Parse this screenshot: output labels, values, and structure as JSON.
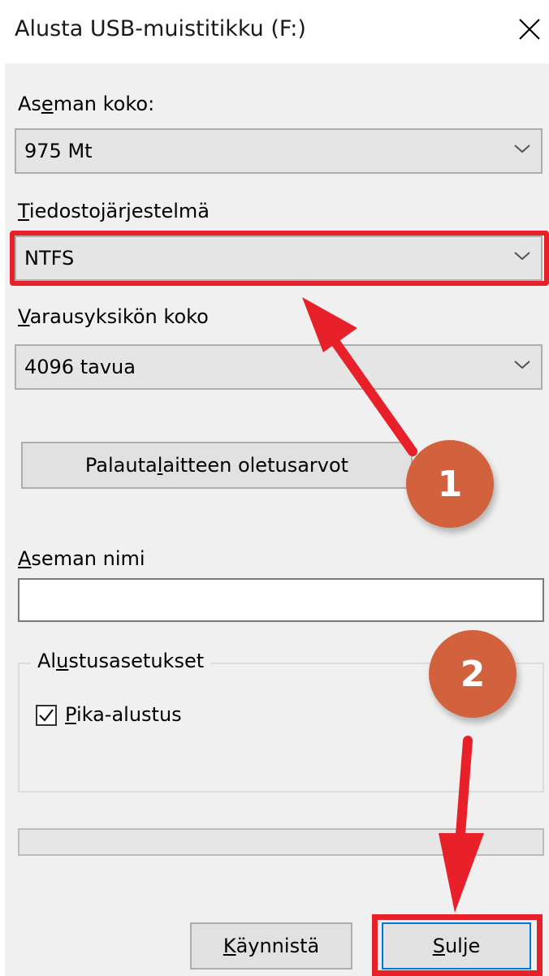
{
  "window": {
    "title": "Alusta USB-muistitikku (F:)",
    "close_glyph": "✕"
  },
  "capacity": {
    "label_pre": "As",
    "label_key": "e",
    "label_post": "man koko:",
    "value": "975 Mt"
  },
  "file_system": {
    "label_key": "T",
    "label_post": "iedostojärjestelmä",
    "value": "NTFS"
  },
  "allocation": {
    "label_key": "V",
    "label_post": "arausyksikön koko",
    "value": "4096 tavua"
  },
  "restore_button": {
    "label_pre": "Palauta ",
    "label_key": "l",
    "label_post": "aitteen oletusarvot"
  },
  "volume_label": {
    "label_key": "A",
    "label_post": "seman nimi",
    "value": ""
  },
  "format_options": {
    "title_pre": "Al",
    "title_key": "u",
    "title_post": "stusasetukset",
    "quick_format": {
      "label_key": "P",
      "label_post": "ika-alustus",
      "checked": true
    }
  },
  "progress": {
    "value": 0
  },
  "buttons": {
    "start_key": "K",
    "start_post": "äynnistä",
    "close_key": "S",
    "close_post": "ulje"
  },
  "annotations": {
    "badge_1": "1",
    "badge_2": "2",
    "highlight_color": "#e8202a",
    "badge_color": "#d2623e"
  }
}
